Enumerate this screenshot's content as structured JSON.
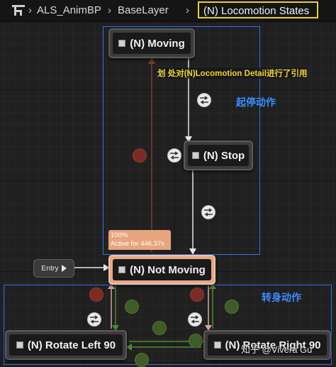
{
  "breadcrumb": {
    "items": [
      "ALS_AnimBP",
      "BaseLayer"
    ],
    "current": "(N) Locomotion States"
  },
  "nodes": {
    "moving": "(N) Moving",
    "stop": "(N) Stop",
    "not_moving": "(N) Not Moving",
    "rotate_left": "(N) Rotate Left 90",
    "rotate_right": "(N) Rotate Right 90"
  },
  "entry": {
    "label": "Entry"
  },
  "active_badge": {
    "line1": "100%",
    "line2": "Active for 446.37s"
  },
  "annotations": {
    "reference": "划 处对(N)Locomotion Detail进行了引用",
    "start_stop": "起停动作",
    "turn": "转身动作"
  },
  "watermark": "知乎 @Vivera Gu",
  "colors": {
    "highlight_box": "#2f6ff0",
    "annotation_text": "#3a8cff",
    "breadcrumb_highlight": "#e9cf33",
    "active_state": "#e6a984",
    "reference_text": "#f0d22f"
  }
}
